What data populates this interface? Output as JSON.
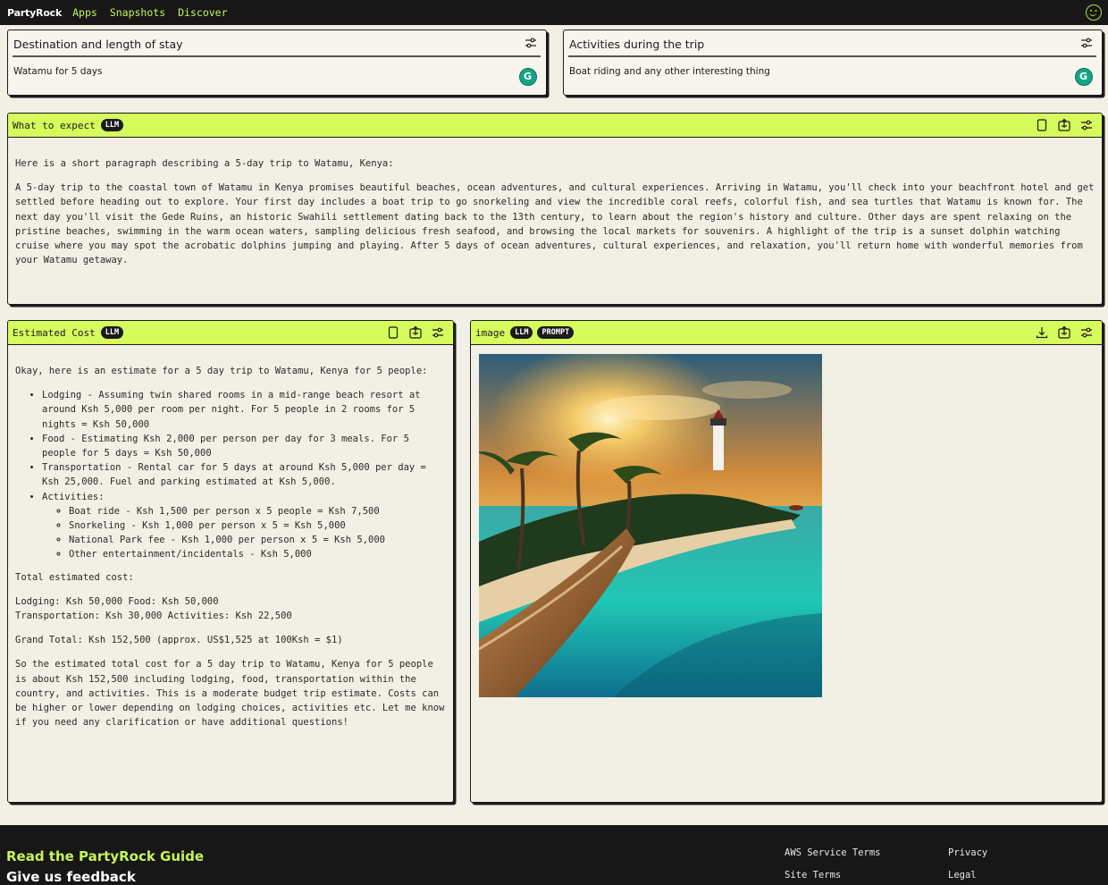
{
  "nav": {
    "brand": "PartyRock",
    "links": [
      "Apps",
      "Snapshots",
      "Discover"
    ]
  },
  "inputs": [
    {
      "label": "Destination and length of stay",
      "value": "Watamu for 5 days"
    },
    {
      "label": "Activities during the trip",
      "value": "Boat riding and any other interesting thing"
    }
  ],
  "what_to_expect": {
    "title": "What to expect",
    "badges": [
      "LLM"
    ],
    "intro": "Here is a short paragraph describing a 5-day trip to Watamu, Kenya:",
    "paragraph": "A 5-day trip to the coastal town of Watamu in Kenya promises beautiful beaches, ocean adventures, and cultural experiences. Arriving in Watamu, you'll check into your beachfront hotel and get settled before heading out to explore. Your first day includes a boat trip to go snorkeling and view the incredible coral reefs, colorful fish, and sea turtles that Watamu is known for. The next day you'll visit the Gede Ruins, an historic Swahili settlement dating back to the 13th century, to learn about the region's history and culture. Other days are spent relaxing on the pristine beaches, swimming in the warm ocean waters, sampling delicious fresh seafood, and browsing the local markets for souvenirs. A highlight of the trip is a sunset dolphin watching cruise where you may spot the acrobatic dolphins jumping and playing. After 5 days of ocean adventures, cultural experiences, and relaxation, you'll return home with wonderful memories from your Watamu getaway."
  },
  "estimated_cost": {
    "title": "Estimated Cost",
    "badges": [
      "LLM"
    ],
    "intro": "Okay, here is an estimate for a 5 day trip to Watamu, Kenya for 5 people:",
    "items": [
      "Lodging - Assuming twin shared rooms in a mid-range beach resort at around Ksh 5,000 per room per night. For 5 people in 2 rooms for 5 nights = Ksh 50,000",
      "Food - Estimating Ksh 2,000 per person per day for 3 meals. For 5 people for 5 days = Ksh 50,000",
      "Transportation - Rental car for 5 days at around Ksh 5,000 per day = Ksh 25,000. Fuel and parking estimated at Ksh 5,000.",
      "Activities:"
    ],
    "activities": [
      "Boat ride - Ksh 1,500 per person x 5 people = Ksh 7,500",
      "Snorkeling - Ksh 1,000 per person x 5 = Ksh 5,000",
      "National Park fee - Ksh 1,000 per person x 5 = Ksh 5,000",
      "Other entertainment/incidentals - Ksh 5,000"
    ],
    "total_label": "Total estimated cost:",
    "breakdown_line1": "Lodging: Ksh 50,000 Food: Ksh 50,000",
    "breakdown_line2": "Transportation: Ksh 30,000 Activities: Ksh 22,500",
    "grand_total": "Grand Total: Ksh 152,500 (approx. US$1,525 at 100Ksh = $1)",
    "closing": "So the estimated total cost for a 5 day trip to Watamu, Kenya for 5 people is about Ksh 152,500 including lodging, food, transportation within the country, and activities. This is a moderate budget trip estimate. Costs can be higher or lower depending on lodging choices, activities etc. Let me know if you need any clarification or have additional questions!"
  },
  "image_widget": {
    "title": "image",
    "badges": [
      "LLM",
      "PROMPT"
    ]
  },
  "footer": {
    "guide": "Read the PartyRock Guide",
    "feedback": "Give us feedback",
    "links": [
      "AWS Service Terms",
      "Privacy",
      "Site Terms",
      "Legal"
    ]
  },
  "colors": {
    "accent": "#d5fb5c",
    "nav_bg": "#171717",
    "page_bg": "#f2efe4",
    "grammarly": "#15a586"
  }
}
